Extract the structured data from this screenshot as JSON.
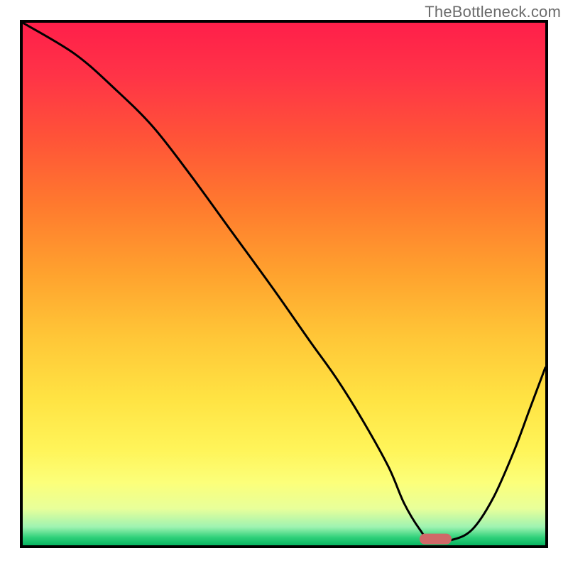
{
  "watermark": "TheBottleneck.com",
  "colors": {
    "border": "#000000",
    "line": "#000000",
    "marker_fill": "#d06868",
    "marker_stroke": "#d06868",
    "gradient_stops": [
      {
        "offset": 0.0,
        "color": "#ff1f4a"
      },
      {
        "offset": 0.1,
        "color": "#ff3347"
      },
      {
        "offset": 0.22,
        "color": "#ff5338"
      },
      {
        "offset": 0.35,
        "color": "#ff7a2e"
      },
      {
        "offset": 0.48,
        "color": "#ffa22e"
      },
      {
        "offset": 0.6,
        "color": "#ffc637"
      },
      {
        "offset": 0.72,
        "color": "#ffe343"
      },
      {
        "offset": 0.82,
        "color": "#fff55a"
      },
      {
        "offset": 0.88,
        "color": "#fcff7a"
      },
      {
        "offset": 0.93,
        "color": "#e8ff9a"
      },
      {
        "offset": 0.965,
        "color": "#9ef3b1"
      },
      {
        "offset": 0.985,
        "color": "#2fd07a"
      },
      {
        "offset": 1.0,
        "color": "#06b460"
      }
    ]
  },
  "chart_data": {
    "type": "line",
    "title": "",
    "xlabel": "",
    "ylabel": "",
    "xlim": [
      0,
      100
    ],
    "ylim": [
      0,
      100
    ],
    "x": [
      0,
      10,
      18,
      25,
      32,
      40,
      48,
      55,
      60,
      65,
      70,
      73,
      76,
      78,
      82,
      86,
      90,
      94,
      97,
      100
    ],
    "values": [
      100,
      94,
      87,
      80,
      71,
      60,
      49,
      39,
      32,
      24,
      15,
      8,
      3,
      1,
      1,
      3,
      9,
      18,
      26,
      34
    ],
    "marker": {
      "x_start": 76,
      "x_end": 82,
      "y": 1.2
    },
    "annotations": []
  }
}
